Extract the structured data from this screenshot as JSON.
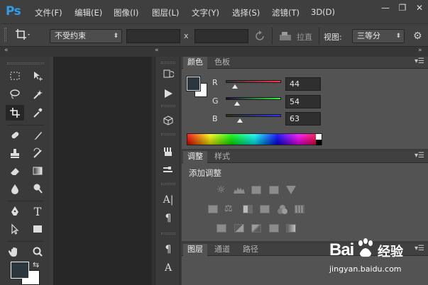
{
  "menubar": {
    "logo": "Ps",
    "items": [
      "文件(F)",
      "编辑(E)",
      "图像(I)",
      "图层(L)",
      "文字(Y)",
      "选择(S)",
      "滤镜(T)",
      "3D(D)"
    ],
    "window_buttons": {
      "minimize": "—",
      "restore": "❐",
      "close": "✕"
    }
  },
  "options": {
    "ratio_select": "不受约束",
    "width_value": "",
    "x_label": "x",
    "height_value": "",
    "straighten_label": "拉直",
    "view_label": "视图:",
    "view_select": "三等分"
  },
  "color_panel": {
    "tabs": [
      "颜色",
      "色板"
    ],
    "channels": [
      {
        "label": "R",
        "value": "44",
        "level": 0.17
      },
      {
        "label": "G",
        "value": "54",
        "level": 0.21
      },
      {
        "label": "B",
        "value": "63",
        "level": 0.25
      }
    ],
    "fg_color": "#2c363f",
    "bg_color": "#ffffff"
  },
  "adjust_panel": {
    "tabs": [
      "调整",
      "样式"
    ],
    "heading": "添加调整"
  },
  "layers_panel": {
    "tabs": [
      "图层",
      "通道",
      "路径"
    ]
  },
  "watermark": {
    "brand": "Bai",
    "brand_suffix": "经验",
    "url": "jingyan.baidu.com"
  },
  "colors": {
    "menubar": "#3f3f3f",
    "panel": "#535353",
    "accent": "#2f9ee8",
    "canvas": "#272727"
  }
}
